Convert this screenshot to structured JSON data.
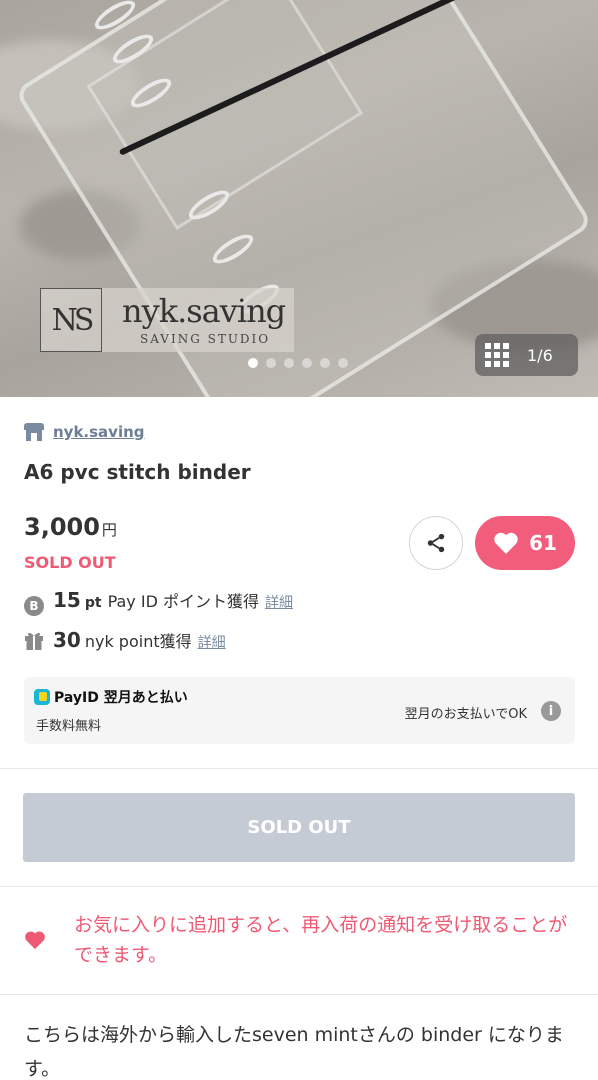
{
  "hero": {
    "logo_mark": "NS",
    "logo_name": "nyk.saving",
    "logo_sub": "SAVING STUDIO",
    "counter": "1/6",
    "total_images": 6,
    "current_image": 1
  },
  "shop": {
    "name": "nyk.saving",
    "icon": "shop-icon"
  },
  "product": {
    "title": "A6 pvc stitch binder",
    "price": "3,000",
    "currency": "円",
    "status": "SOLD OUT",
    "likes": "61"
  },
  "points": {
    "payid": {
      "value": "15",
      "unit": "pt",
      "label": "Pay ID ポイント獲得",
      "detail": "詳細",
      "icon": "coin-icon"
    },
    "nyk": {
      "value": "30",
      "label": "nyk point獲得",
      "detail": "詳細",
      "icon": "gift-icon"
    }
  },
  "payid_box": {
    "logo": "PayID 翌月あと払い",
    "fee": "手数料無料",
    "note": "翌月のお支払いでOK"
  },
  "sold_button": "SOLD OUT",
  "notice": "お気に入りに追加すると、再入荷の通知を受け取ることができます。",
  "description": "こちらは海外から輸入したseven mintさんの binder になります。",
  "colors": {
    "accent": "#f25d7b",
    "link": "#6d7d93",
    "disabled": "#c5cbd4"
  }
}
